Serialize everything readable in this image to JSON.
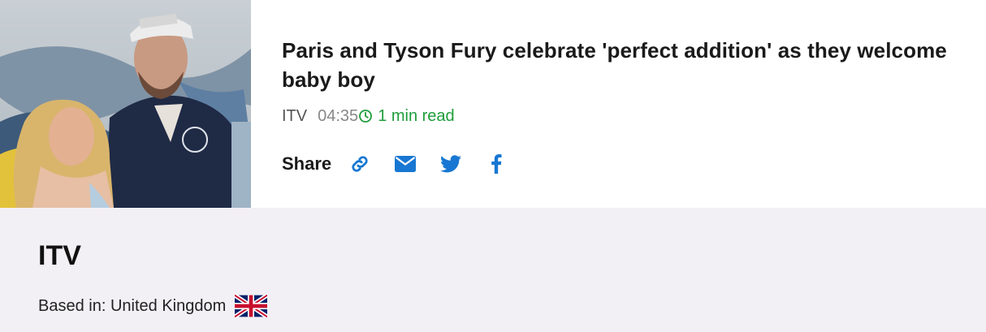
{
  "article": {
    "image_alt": "Paris and Tyson Fury photo",
    "headline": "Paris and Tyson Fury celebrate 'perfect addition' as they welcome baby boy",
    "source": "ITV",
    "time": "04:35",
    "read_time": "1 min read"
  },
  "share": {
    "label": "Share",
    "buttons": [
      "link-icon",
      "email-icon",
      "twitter-icon",
      "facebook-icon"
    ],
    "icon_color": "#1877d2"
  },
  "publisher": {
    "name": "ITV",
    "based_in": "Based in: United Kingdom",
    "flag": "uk-flag-icon"
  },
  "colors": {
    "accent_green": "#1f9d3a",
    "share_blue": "#1877d2",
    "publisher_bg": "#f2f0f5"
  }
}
